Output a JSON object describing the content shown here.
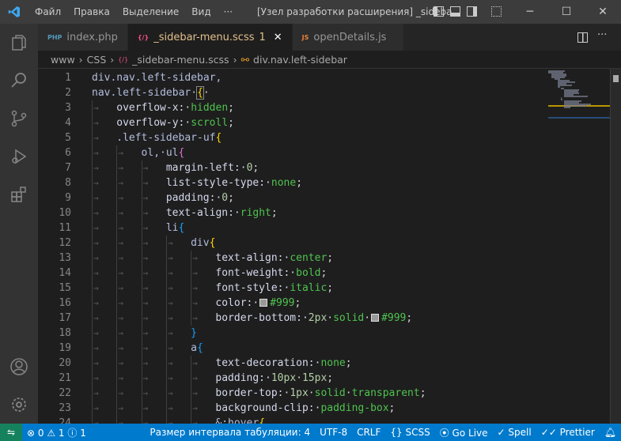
{
  "titlebar": {
    "menus": [
      "Файл",
      "Правка",
      "Выделение",
      "Вид",
      "···"
    ],
    "title": "[Узел разработки расширения] _sideba..."
  },
  "tabs": [
    {
      "icon": "PHP",
      "label": "index.php",
      "icon_color": "#519aba"
    },
    {
      "icon": "{/}",
      "label": "_sidebar-menu.scss",
      "badge": "1",
      "close": "✕",
      "icon_color": "#f55385"
    },
    {
      "icon": "JS",
      "label": "openDetails.js",
      "icon_color": "#e8803a"
    }
  ],
  "breadcrumb": [
    "www",
    "CSS",
    "_sidebar-menu.scss",
    "div.nav.left-sidebar"
  ],
  "colors": {
    "selector": "#b3bdde",
    "property": "#d4d8ec",
    "value": "#4fc34f",
    "number": "#b5cea8",
    "punct": "#d4d4d4",
    "gold": "#ffd700",
    "orchid": "#da70d6",
    "blue": "#179fff",
    "accent": "#007acc"
  },
  "code": [
    {
      "n": "1",
      "i": 0,
      "t": [
        [
          "div.nav.left-sidebar,",
          "selector"
        ]
      ]
    },
    {
      "n": "2",
      "i": 0,
      "t": [
        [
          "nav.left-sidebar·",
          "selector"
        ],
        [
          "{",
          "gold",
          "box"
        ],
        [
          "·",
          "punct"
        ]
      ]
    },
    {
      "n": "3",
      "i": 1,
      "t": [
        [
          "overflow-x:·",
          "property"
        ],
        [
          "hidden",
          "value"
        ],
        [
          ";",
          "punct"
        ]
      ]
    },
    {
      "n": "4",
      "i": 1,
      "t": [
        [
          "overflow-y:·",
          "property"
        ],
        [
          "scroll",
          "value"
        ],
        [
          ";",
          "punct"
        ]
      ]
    },
    {
      "n": "5",
      "i": 1,
      "t": [
        [
          ".left-sidebar-uf",
          "selector"
        ],
        [
          "{",
          "gold"
        ]
      ]
    },
    {
      "n": "6",
      "i": 2,
      "t": [
        [
          "ol,·ul",
          "selector"
        ],
        [
          "{",
          "orchid"
        ]
      ]
    },
    {
      "n": "7",
      "i": 3,
      "t": [
        [
          "margin-left:·",
          "property"
        ],
        [
          "0",
          "number"
        ],
        [
          ";",
          "punct"
        ]
      ]
    },
    {
      "n": "8",
      "i": 3,
      "t": [
        [
          "list-style-type:·",
          "property"
        ],
        [
          "none",
          "value"
        ],
        [
          ";",
          "punct"
        ]
      ]
    },
    {
      "n": "9",
      "i": 3,
      "t": [
        [
          "padding:·",
          "property"
        ],
        [
          "0",
          "number"
        ],
        [
          ";",
          "punct"
        ]
      ]
    },
    {
      "n": "10",
      "i": 3,
      "t": [
        [
          "text-align:·",
          "property"
        ],
        [
          "right",
          "value"
        ],
        [
          ";",
          "punct"
        ]
      ]
    },
    {
      "n": "11",
      "i": 3,
      "t": [
        [
          "li",
          "selector"
        ],
        [
          "{",
          "blue"
        ]
      ]
    },
    {
      "n": "12",
      "i": 4,
      "t": [
        [
          "div",
          "selector"
        ],
        [
          "{",
          "gold"
        ]
      ]
    },
    {
      "n": "13",
      "i": 5,
      "t": [
        [
          "text-align:·",
          "property"
        ],
        [
          "center",
          "value"
        ],
        [
          ";",
          "punct"
        ]
      ]
    },
    {
      "n": "14",
      "i": 5,
      "t": [
        [
          "font-weight:·",
          "property"
        ],
        [
          "bold",
          "value"
        ],
        [
          ";",
          "punct"
        ]
      ]
    },
    {
      "n": "15",
      "i": 5,
      "t": [
        [
          "font-style:·",
          "property"
        ],
        [
          "italic",
          "value"
        ],
        [
          ";",
          "punct"
        ]
      ]
    },
    {
      "n": "16",
      "i": 5,
      "t": [
        [
          "color:·",
          "property"
        ],
        [
          "",
          "swatch"
        ],
        [
          "#999",
          "value"
        ],
        [
          ";",
          "punct"
        ]
      ]
    },
    {
      "n": "17",
      "i": 5,
      "t": [
        [
          "border-bottom:·",
          "property"
        ],
        [
          "2px",
          "number"
        ],
        [
          "·",
          "punct"
        ],
        [
          "solid",
          "value"
        ],
        [
          "·",
          "punct"
        ],
        [
          "",
          "swatch"
        ],
        [
          "#999",
          "value"
        ],
        [
          ";",
          "punct"
        ]
      ]
    },
    {
      "n": "18",
      "i": 4,
      "t": [
        [
          "}",
          "blue"
        ]
      ]
    },
    {
      "n": "19",
      "i": 4,
      "t": [
        [
          "a",
          "selector"
        ],
        [
          "{",
          "blue"
        ]
      ]
    },
    {
      "n": "20",
      "i": 5,
      "t": [
        [
          "text-decoration:·",
          "property"
        ],
        [
          "none",
          "value"
        ],
        [
          ";",
          "punct"
        ]
      ]
    },
    {
      "n": "21",
      "i": 5,
      "t": [
        [
          "padding:·",
          "property"
        ],
        [
          "10px",
          "number"
        ],
        [
          "·",
          "punct"
        ],
        [
          "15px",
          "number"
        ],
        [
          ";",
          "punct"
        ]
      ]
    },
    {
      "n": "22",
      "i": 5,
      "t": [
        [
          "border-top:·",
          "property"
        ],
        [
          "1px",
          "number"
        ],
        [
          "·",
          "punct"
        ],
        [
          "solid",
          "value"
        ],
        [
          "·",
          "punct"
        ],
        [
          "transparent",
          "value"
        ],
        [
          ";",
          "punct"
        ]
      ]
    },
    {
      "n": "23",
      "i": 5,
      "t": [
        [
          "background-clip:·",
          "property"
        ],
        [
          "padding-box",
          "value"
        ],
        [
          ";",
          "punct"
        ]
      ]
    },
    {
      "n": "24",
      "i": 5,
      "t": [
        [
          "&:hover",
          "selector"
        ],
        [
          "{",
          "gold"
        ]
      ]
    }
  ],
  "statusbar": {
    "errors": "0",
    "warnings": "1",
    "info": "1",
    "tab_size": "Размер интервала табуляции: 4",
    "encoding": "UTF-8",
    "eol": "CRLF",
    "language": "SCSS",
    "golive": "Go Live",
    "spell": "Spell",
    "prettier": "Prettier"
  }
}
